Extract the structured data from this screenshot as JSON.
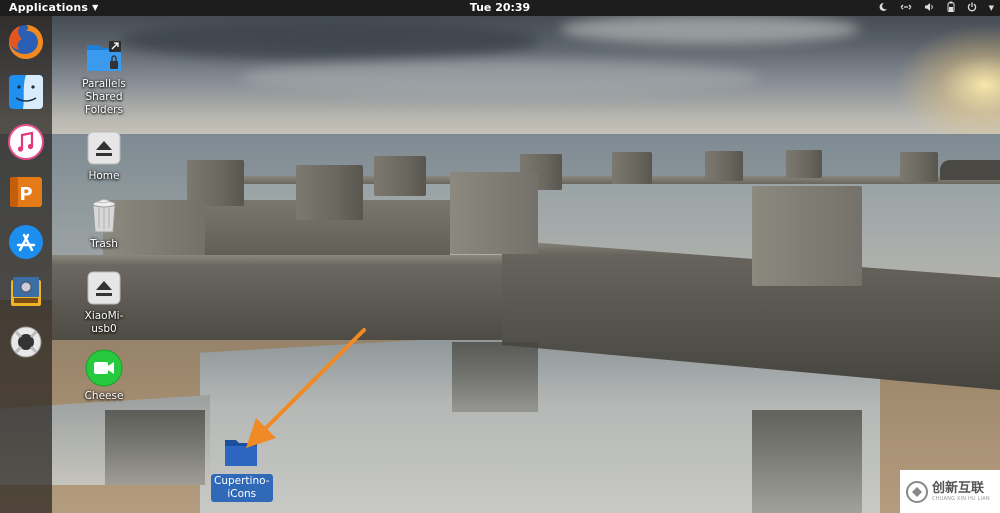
{
  "topbar": {
    "applications_label": "Applications",
    "clock": "Tue 20:39",
    "tray_icons": [
      "night-light-icon",
      "network-icon",
      "volume-icon",
      "battery-icon",
      "power-icon"
    ]
  },
  "dock": {
    "items": [
      {
        "name": "firefox",
        "icon": "firefox-icon"
      },
      {
        "name": "finder",
        "icon": "finder-icon"
      },
      {
        "name": "itunes",
        "icon": "music-icon"
      },
      {
        "name": "presentation",
        "icon": "presentation-icon"
      },
      {
        "name": "app-store",
        "icon": "app-store-icon"
      },
      {
        "name": "preview",
        "icon": "preview-icon"
      },
      {
        "name": "help",
        "icon": "lifebuoy-icon"
      }
    ]
  },
  "desktop": {
    "icons": [
      {
        "label": "Parallels\nShared\nFolders",
        "icon": "shared-folder-icon"
      },
      {
        "label": "Home",
        "icon": "eject-drive-icon"
      },
      {
        "label": "Trash",
        "icon": "trash-icon"
      },
      {
        "label": "XiaoMi-\nusb0",
        "icon": "eject-drive-icon"
      },
      {
        "label": "Cheese",
        "icon": "camera-icon"
      },
      {
        "label": "Cupertino-\niCons",
        "icon": "folder-icon",
        "selected": true
      }
    ]
  },
  "watermark": {
    "text": "创新互联",
    "sub": "CHUANG XIN HU LIAN"
  },
  "colors": {
    "topbar": "#1d1d1d",
    "dock": "#2b2520",
    "selection": "#3069b8",
    "annotation_arrow": "#f08a24"
  }
}
